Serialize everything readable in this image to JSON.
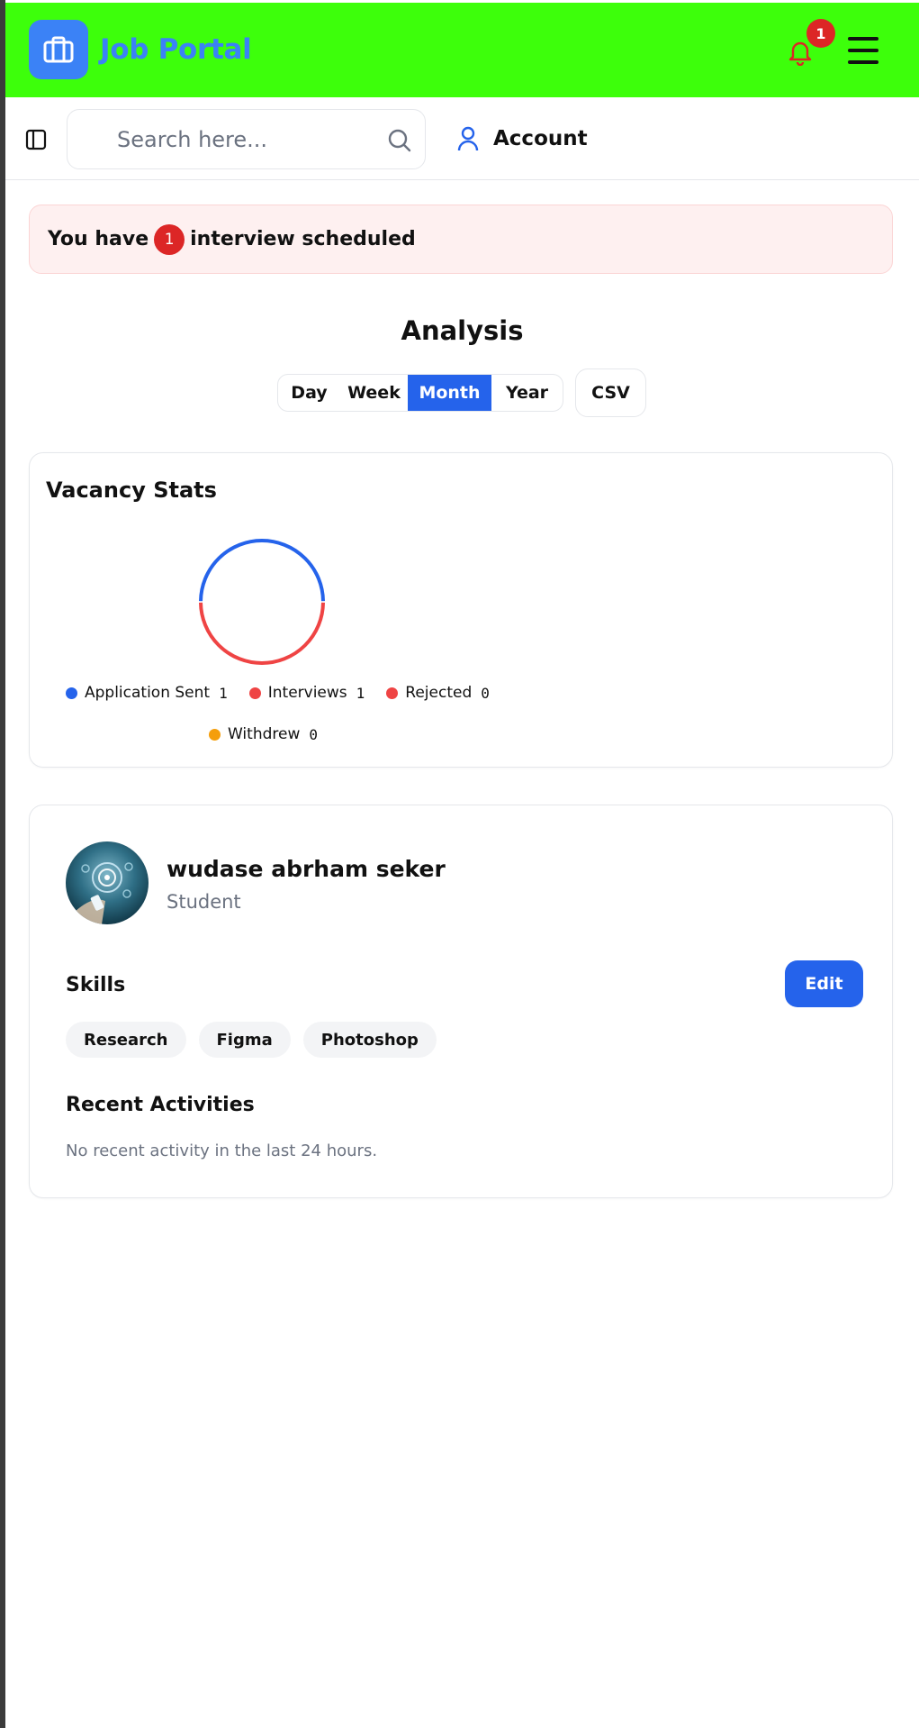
{
  "app": {
    "brand": "Job Portal",
    "notification_count": "1",
    "icons": {
      "logo": "briefcase-icon",
      "notifications": "bell-icon",
      "menu": "hamburger-menu-icon",
      "sidebar": "sidebar-toggle-icon",
      "search": "search-icon",
      "account": "user-icon"
    },
    "colors": {
      "topbar": "#3dff0b",
      "brand": "#3b82f6",
      "primary": "#2563eb",
      "danger": "#dc2626",
      "warning": "#f59e0b"
    }
  },
  "subheader": {
    "search_placeholder": "Search here...",
    "account_label": "Account"
  },
  "alert": {
    "prefix": "You have",
    "count": "1",
    "suffix": "interview scheduled"
  },
  "analysis": {
    "title": "Analysis",
    "periods": [
      "Day",
      "Week",
      "Month",
      "Year"
    ],
    "selected_period": "Month",
    "csv_label": "CSV"
  },
  "vacancy": {
    "title": "Vacancy Stats",
    "chart_data": {
      "type": "pie",
      "categories": [
        "Application Sent",
        "Interviews",
        "Rejected",
        "Withdrew"
      ],
      "values": [
        1,
        1,
        0,
        0
      ],
      "colors": [
        "#2563eb",
        "#ef4444",
        "#ef4444",
        "#f59e0b"
      ],
      "legend": "bottom"
    }
  },
  "profile": {
    "name": "wudase abrham seker",
    "role": "Student",
    "skills_title": "Skills",
    "edit_label": "Edit",
    "skills": [
      "Research",
      "Figma",
      "Photoshop"
    ],
    "recent_title": "Recent Activities",
    "recent_empty": "No recent activity in the last 24 hours."
  }
}
